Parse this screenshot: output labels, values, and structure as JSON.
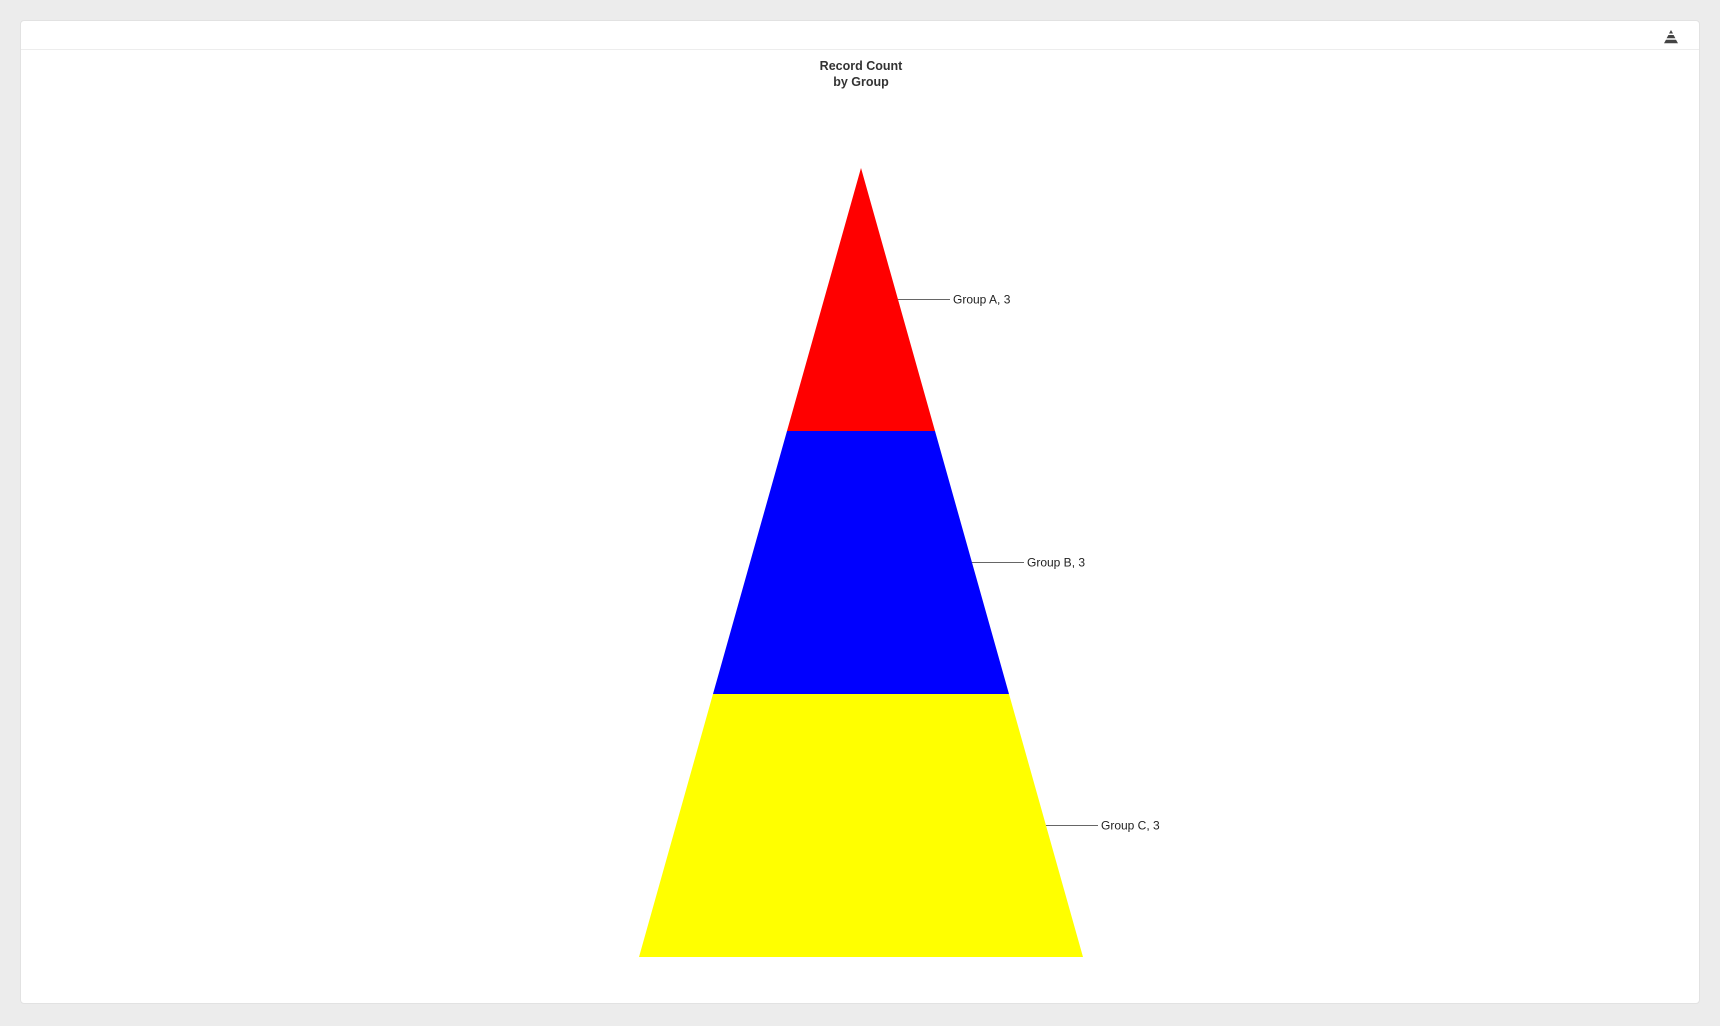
{
  "toolbar": {
    "chart_type_icon": "pyramid-chart-icon"
  },
  "chart_data": {
    "type": "pyramid",
    "title": [
      "Record Count",
      "by Group"
    ],
    "categories": [
      "Group A",
      "Group B",
      "Group C"
    ],
    "values": [
      3,
      3,
      3
    ],
    "labels": [
      "Group A, 3",
      "Group B, 3",
      "Group C, 3"
    ],
    "colors": [
      "#ff0000",
      "#0000ff",
      "#ffff00"
    ]
  }
}
